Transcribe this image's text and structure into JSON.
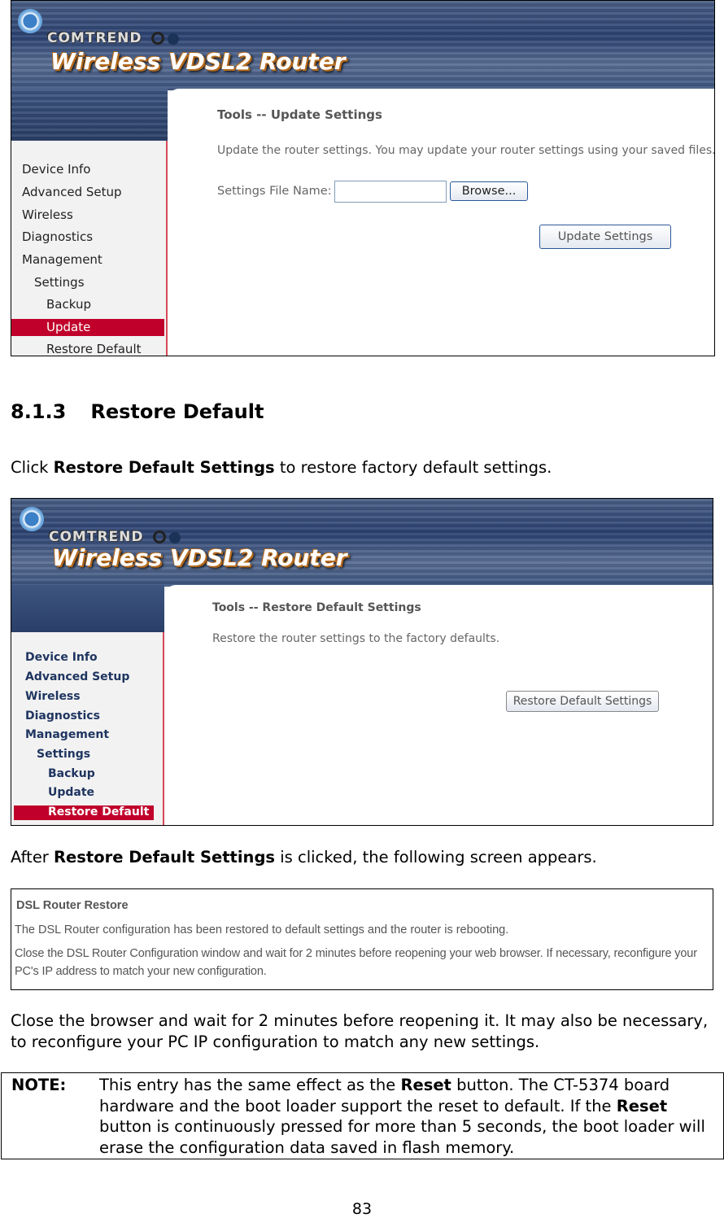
{
  "screenshot1": {
    "logo": "COMTREND",
    "product_title": "Wireless VDSL2 Router",
    "nav": [
      "Device Info",
      "Advanced Setup",
      "Wireless",
      "Diagnostics",
      "Management",
      "Settings",
      "Backup",
      "Update",
      "Restore Default"
    ],
    "selected_nav": "Update",
    "page_title": "Tools -- Update Settings",
    "description": "Update the router settings. You may update your router settings using your saved files.",
    "file_label": "Settings File Name:",
    "file_value": "",
    "browse_button": "Browse...",
    "update_button": "Update Settings"
  },
  "section": {
    "number": "8.1.3",
    "title": "Restore Default"
  },
  "para1": {
    "pre": "Click ",
    "bold": "Restore Default Settings",
    "post": " to restore factory default settings."
  },
  "screenshot2": {
    "logo": "COMTREND",
    "product_title": "Wireless VDSL2 Router",
    "nav": [
      "Device Info",
      "Advanced Setup",
      "Wireless",
      "Diagnostics",
      "Management",
      "Settings",
      "Backup",
      "Update",
      "Restore Default"
    ],
    "selected_nav": "Restore Default",
    "page_title": "Tools -- Restore Default Settings",
    "description": "Restore the router settings to the factory defaults.",
    "restore_button": "Restore Default Settings"
  },
  "para2": {
    "pre": "After ",
    "bold": "Restore Default Settings",
    "post": " is clicked, the following screen appears."
  },
  "screenshot3": {
    "title": "DSL Router Restore",
    "line1": "The DSL Router configuration has been restored to default settings and the router is rebooting.",
    "line2": "Close the DSL Router Configuration window and wait for 2 minutes before reopening your web browser. If necessary, reconfigure your PC's IP address to match your new configuration."
  },
  "para3": "Close the browser and wait for 2 minutes before reopening it. It may also be necessary, to reconfigure your PC IP configuration to match any new settings.",
  "note": {
    "label": "NOTE:",
    "t1": "This entry has the same effect as the ",
    "b1": "Reset",
    "t2": " button. The CT-5374 board hardware and the boot loader support the reset to default. If the ",
    "b2": "Reset",
    "t3": " button is continuously pressed for more than 5 seconds, the boot loader will erase the configuration data saved in flash memory."
  },
  "page_number": "83",
  "colors": {
    "banner": "#2c4372",
    "selected_nav": "#c0002a",
    "sidebar_border": "#d44a5a"
  }
}
